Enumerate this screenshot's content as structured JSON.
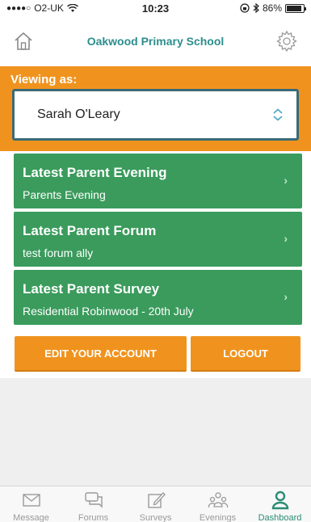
{
  "status_bar": {
    "signal": "●●●●○",
    "carrier": "O2-UK",
    "time": "10:23",
    "battery": "86%"
  },
  "nav": {
    "title": "Oakwood Primary School",
    "icons": [
      "home-icon",
      "gear-icon"
    ]
  },
  "viewing": {
    "label": "Viewing as:",
    "selected": "Sarah O'Leary"
  },
  "cards": [
    {
      "title": "Latest Parent Evening",
      "subtitle": "Parents Evening",
      "arrow": "›"
    },
    {
      "title": "Latest Parent Forum",
      "subtitle": "test forum ally",
      "arrow": "›"
    },
    {
      "title": "Latest Parent Survey",
      "subtitle": "Residential Robinwood - 20th July",
      "arrow": "›"
    }
  ],
  "buttons": {
    "edit": "EDIT YOUR ACCOUNT",
    "logout": "LOGOUT"
  },
  "tabs": [
    {
      "label": "Message",
      "icon": "envelope-icon"
    },
    {
      "label": "Forums",
      "icon": "chat-bubbles-icon"
    },
    {
      "label": "Surveys",
      "icon": "edit-icon"
    },
    {
      "label": "Evenings",
      "icon": "people-icon"
    },
    {
      "label": "Dashboard",
      "icon": "user-icon",
      "active": true
    }
  ],
  "colors": {
    "orange": "#f0931e",
    "green": "#3a9b5c",
    "teal": "#2d8e8e",
    "active_tab": "#2a8c73"
  }
}
